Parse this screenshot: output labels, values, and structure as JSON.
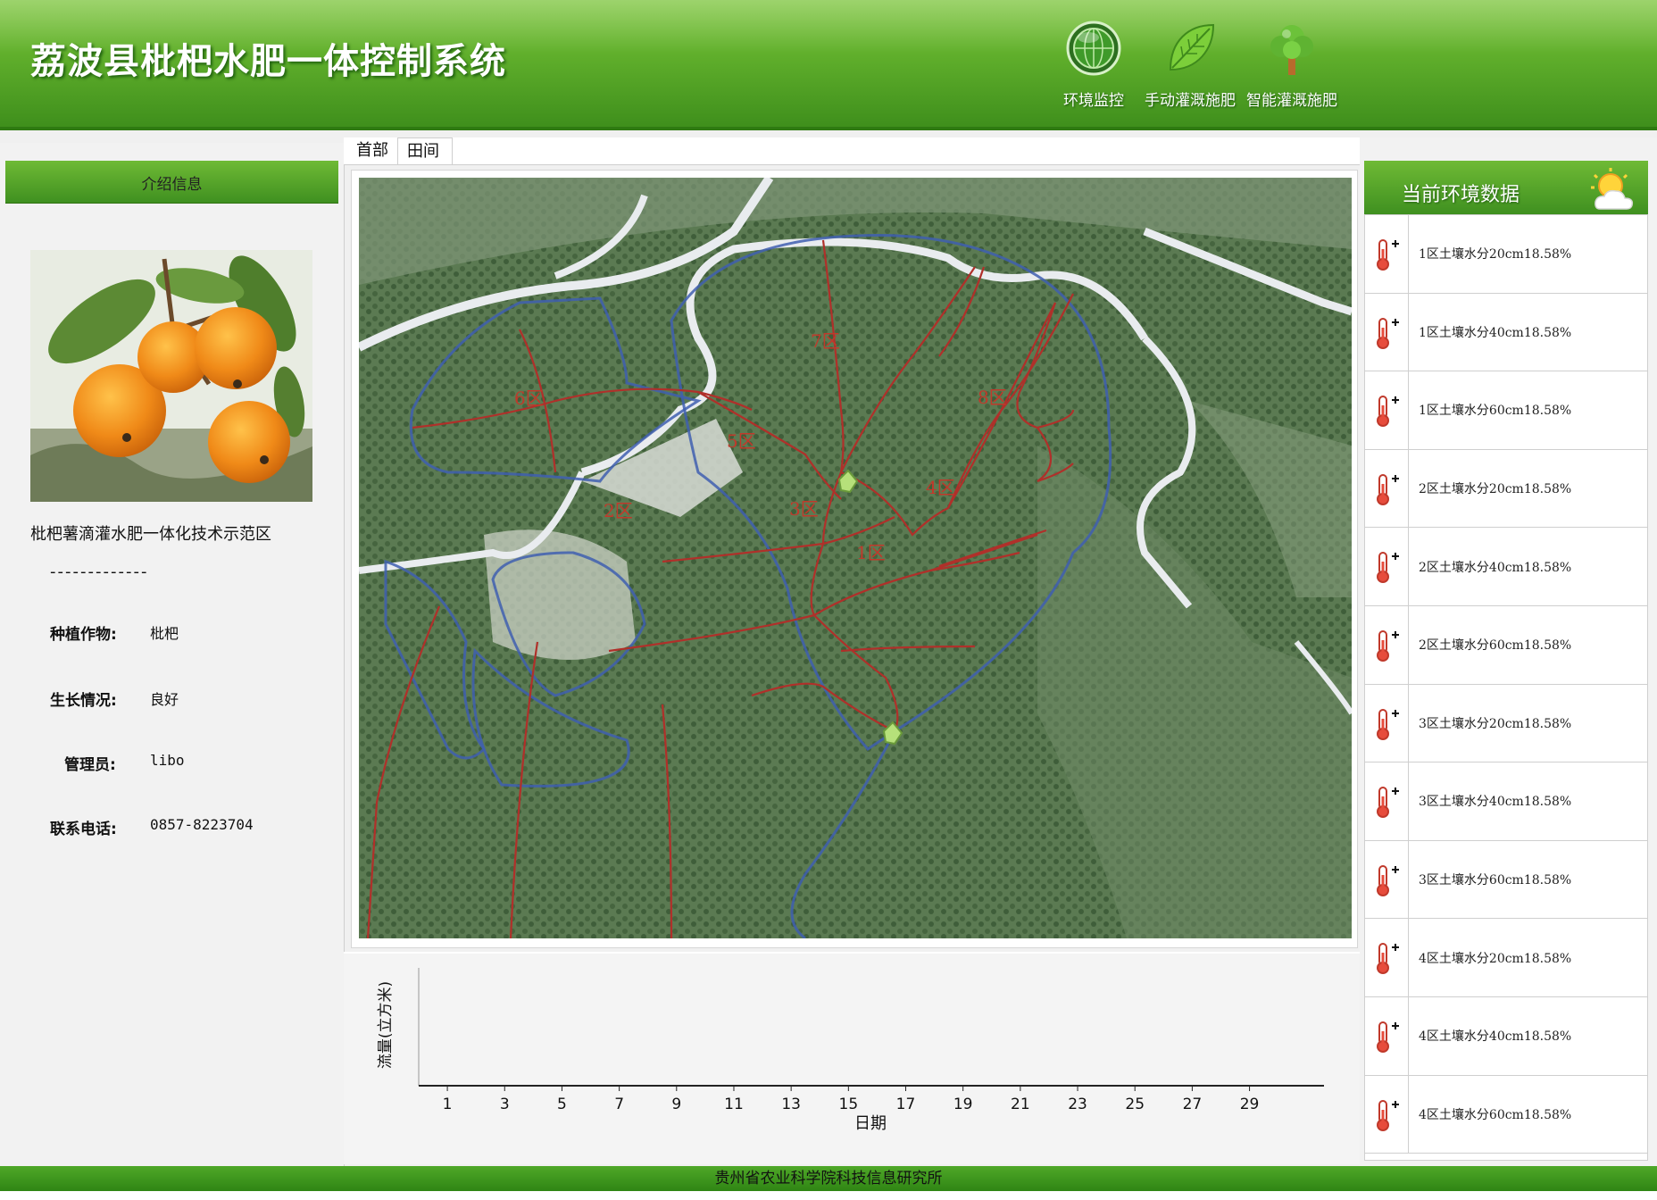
{
  "app": {
    "title": "荔波县枇杷水肥一体控制系统"
  },
  "nav": [
    {
      "label": "环境监控",
      "icon": "radar-globe-icon"
    },
    {
      "label": "手动灌溉施肥",
      "icon": "leaf-icon"
    },
    {
      "label": "智能灌溉施肥",
      "icon": "tree-icon"
    }
  ],
  "intro": {
    "header": "介绍信息",
    "caption": "枇杷薯滴灌水肥一体化技术示范区",
    "divider": "-------------",
    "rows": [
      {
        "key": "种植作物:",
        "value": "枇杷"
      },
      {
        "key": "生长情况:",
        "value": "良好"
      },
      {
        "key": "管理员:",
        "value": "libo"
      },
      {
        "key": "联系电话:",
        "value": "0857-8223704"
      }
    ]
  },
  "tabs": [
    {
      "label": "首部",
      "active": false
    },
    {
      "label": "田间",
      "active": true
    }
  ],
  "map": {
    "zones": [
      {
        "label": "1区"
      },
      {
        "label": "2区"
      },
      {
        "label": "3区"
      },
      {
        "label": "4区"
      },
      {
        "label": "5区"
      },
      {
        "label": "6区"
      },
      {
        "label": "7区"
      },
      {
        "label": "8区"
      }
    ]
  },
  "chart_data": {
    "type": "line",
    "title": "",
    "xlabel": "日期",
    "ylabel": "流量(立方米)",
    "x_ticks": [
      "1",
      "3",
      "5",
      "7",
      "9",
      "11",
      "13",
      "15",
      "17",
      "19",
      "21",
      "23",
      "25",
      "27",
      "29"
    ],
    "series": []
  },
  "env": {
    "title": "当前环境数据",
    "items": [
      "1区土壤水分20cm18.58%",
      "1区土壤水分40cm18.58%",
      "1区土壤水分60cm18.58%",
      "2区土壤水分20cm18.58%",
      "2区土壤水分40cm18.58%",
      "2区土壤水分60cm18.58%",
      "3区土壤水分20cm18.58%",
      "3区土壤水分40cm18.58%",
      "3区土壤水分60cm18.58%",
      "4区土壤水分20cm18.58%",
      "4区土壤水分40cm18.58%",
      "4区土壤水分60cm18.58%"
    ]
  },
  "footer": {
    "text": "贵州省农业科学院科技信息研究所"
  },
  "colors": {
    "brand_green": "#5fae2b",
    "pipe_red": "#b0302a",
    "boundary_blue": "#3f5fb0"
  }
}
